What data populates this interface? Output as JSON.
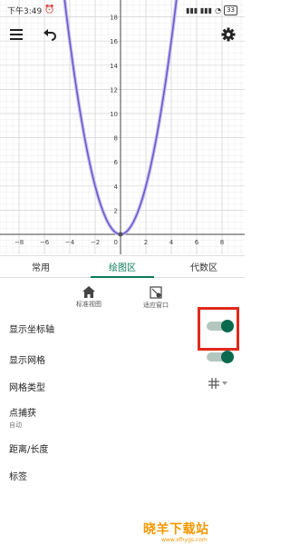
{
  "status_bar": {
    "time": "下午3:49",
    "alarm_icon": "alarm-icon",
    "network": "...",
    "battery": "33"
  },
  "graph": {
    "function": "y = x^2",
    "curve_color": "#6a5acd",
    "x_ticks": [
      "−8",
      "−6",
      "−4",
      "−2",
      "0",
      "2",
      "4",
      "6",
      "8"
    ],
    "y_ticks": [
      "18",
      "16",
      "14",
      "12",
      "10",
      "8",
      "6",
      "4",
      "2"
    ],
    "origin_label": "0"
  },
  "toolbar": {
    "menu_icon": "menu-icon",
    "undo_icon": "undo-icon",
    "settings_icon": "gear-icon"
  },
  "tabs": [
    {
      "label": "常用"
    },
    {
      "label": "绘图区",
      "active": true
    },
    {
      "label": "代数区"
    }
  ],
  "view_buttons": [
    {
      "label": "标准视图",
      "icon": "home-icon"
    },
    {
      "label": "适应窗口",
      "icon": "fit-window-icon"
    }
  ],
  "settings": {
    "show_axes": {
      "label": "显示坐标轴",
      "on": true
    },
    "show_grid": {
      "label": "显示网格",
      "on": true
    },
    "grid_type": {
      "label": "网格类型",
      "icon": "grid-icon"
    },
    "point_capture": {
      "label": "点捕获",
      "value": "自动"
    },
    "distance": {
      "label": "距离/长度"
    },
    "labeling": {
      "label": "标签"
    }
  },
  "accent_color": "#0a7a5b",
  "watermark": {
    "title": "晓羊下载站",
    "url": "www.xfhygs.com"
  }
}
